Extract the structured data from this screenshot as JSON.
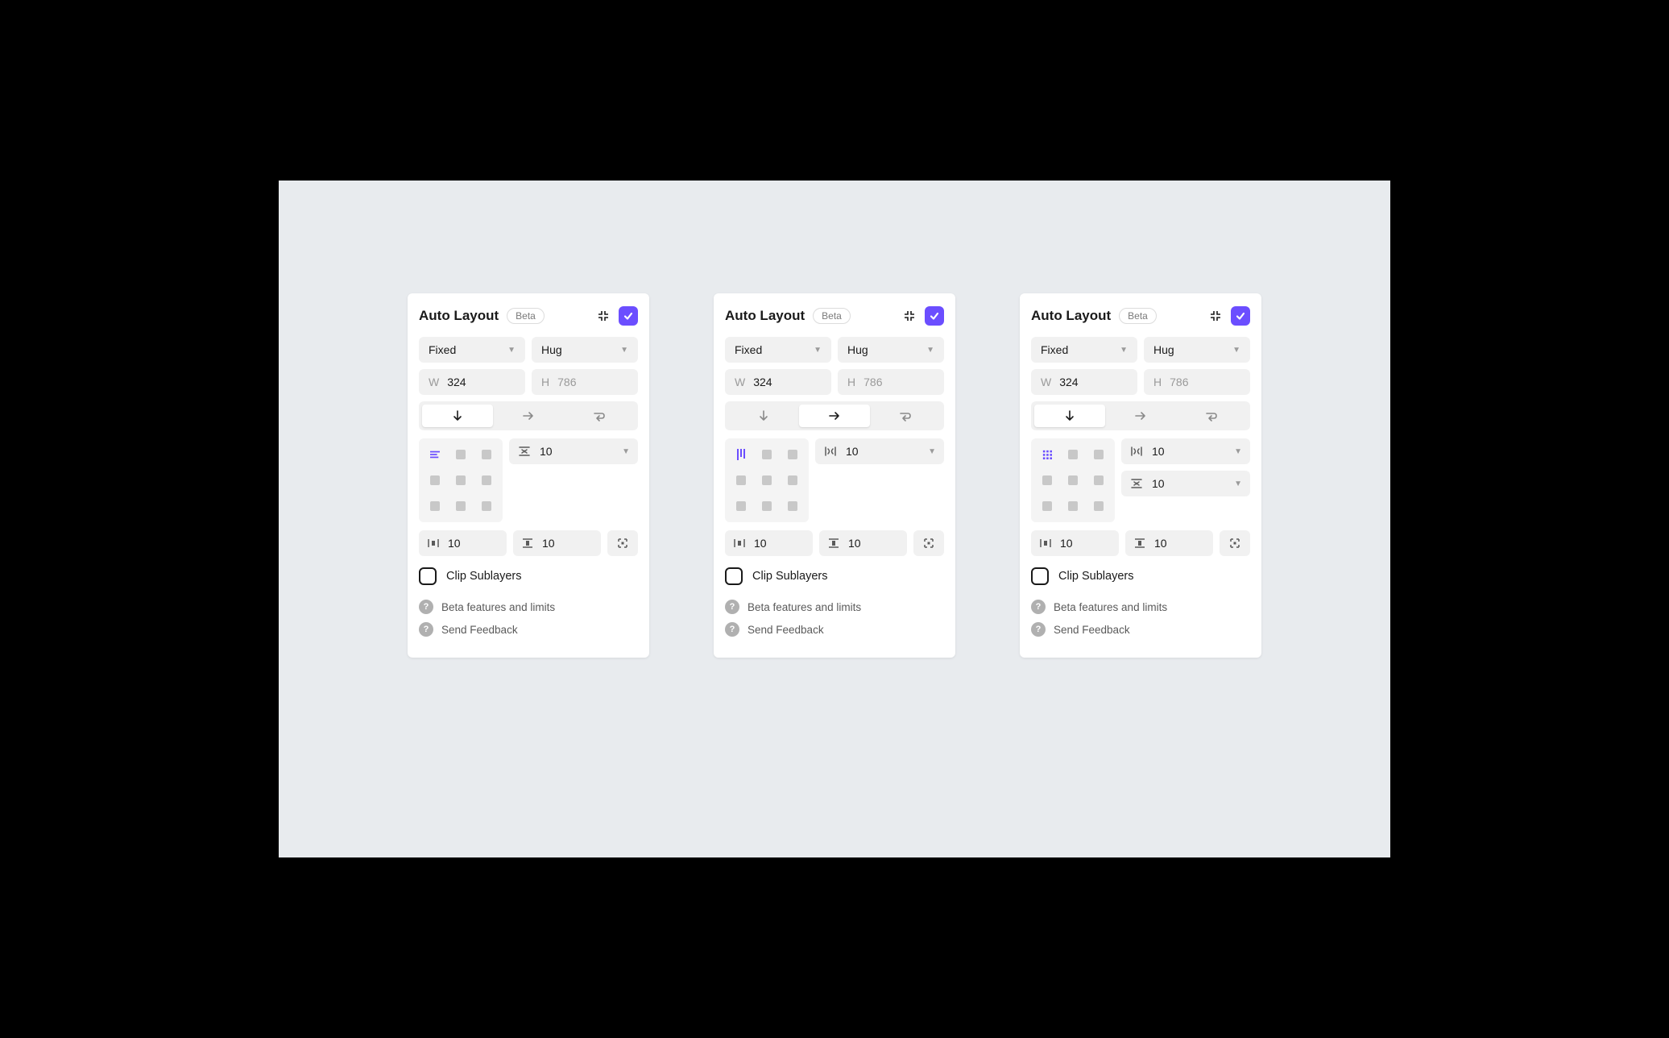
{
  "panels": [
    {
      "title": "Auto Layout",
      "badge": "Beta",
      "width_sizing": "Fixed",
      "height_sizing": "Hug",
      "w_label": "W",
      "w_value": "324",
      "h_label": "H",
      "h_value": "786",
      "direction": "down",
      "align_icon": "lines-h",
      "gaps": [
        {
          "icon": "gap-v",
          "value": "10"
        }
      ],
      "pad_h": "10",
      "pad_v": "10",
      "clip_label": "Clip Sublayers",
      "help1": "Beta features and limits",
      "help2": "Send Feedback"
    },
    {
      "title": "Auto Layout",
      "badge": "Beta",
      "width_sizing": "Fixed",
      "height_sizing": "Hug",
      "w_label": "W",
      "w_value": "324",
      "h_label": "H",
      "h_value": "786",
      "direction": "right",
      "align_icon": "lines-v",
      "gaps": [
        {
          "icon": "gap-h",
          "value": "10"
        }
      ],
      "pad_h": "10",
      "pad_v": "10",
      "clip_label": "Clip Sublayers",
      "help1": "Beta features and limits",
      "help2": "Send Feedback"
    },
    {
      "title": "Auto Layout",
      "badge": "Beta",
      "width_sizing": "Fixed",
      "height_sizing": "Hug",
      "w_label": "W",
      "w_value": "324",
      "h_label": "H",
      "h_value": "786",
      "direction": "down",
      "align_icon": "grid-dots",
      "gaps": [
        {
          "icon": "gap-h",
          "value": "10"
        },
        {
          "icon": "gap-v",
          "value": "10"
        }
      ],
      "pad_h": "10",
      "pad_v": "10",
      "clip_label": "Clip Sublayers",
      "help1": "Beta features and limits",
      "help2": "Send Feedback"
    }
  ]
}
